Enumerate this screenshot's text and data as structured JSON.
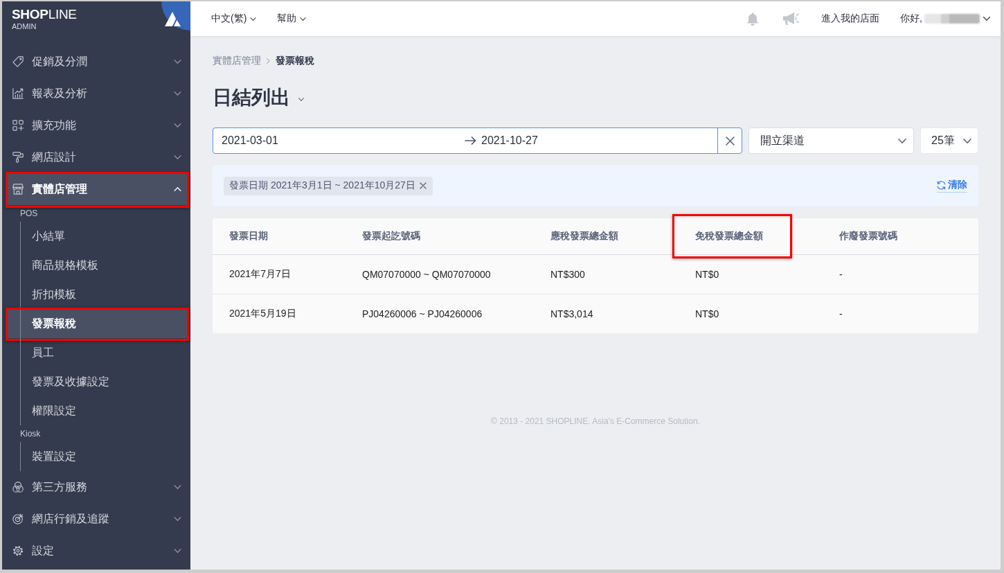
{
  "sidebar": {
    "brand": "**SHOP**LINE",
    "brand_subtitle": "ADMIN",
    "items": [
      {
        "label": "促銷及分潤",
        "expanded": false,
        "selected": false,
        "highlighted": false
      },
      {
        "label": "報表及分析",
        "expanded": false,
        "selected": false,
        "highlighted": false
      },
      {
        "label": "擴充功能",
        "expanded": false,
        "selected": false,
        "highlighted": false
      },
      {
        "label": "網店設計",
        "expanded": false,
        "selected": false,
        "highlighted": false
      },
      {
        "label": "實體店管理",
        "expanded": true,
        "selected": true,
        "highlighted": true,
        "groups": [
          {
            "label": "POS",
            "children": [
              {
                "label": "小結單",
                "selected": false,
                "highlighted": false
              },
              {
                "label": "商品規格模板",
                "selected": false,
                "highlighted": false
              },
              {
                "label": "折扣模板",
                "selected": false,
                "highlighted": false
              },
              {
                "label": "發票報稅",
                "selected": true,
                "highlighted": true
              },
              {
                "label": "員工",
                "selected": false,
                "highlighted": false
              },
              {
                "label": "發票及收據設定",
                "selected": false,
                "highlighted": false
              },
              {
                "label": "權限設定",
                "selected": false,
                "highlighted": false
              }
            ]
          },
          {
            "label": "Kiosk",
            "children": [
              {
                "label": "裝置設定",
                "selected": false,
                "highlighted": false
              }
            ]
          }
        ]
      },
      {
        "label": "第三方服務",
        "expanded": false,
        "selected": false,
        "highlighted": false
      },
      {
        "label": "網店行銷及追蹤",
        "expanded": false,
        "selected": false,
        "highlighted": false
      },
      {
        "label": "設定",
        "expanded": false,
        "selected": false,
        "highlighted": false
      }
    ]
  },
  "topbar": {
    "menus": [
      {
        "label": "中文(繁)"
      },
      {
        "label": "幫助"
      }
    ],
    "store_link": "進入我的店面",
    "greeting": "你好,"
  },
  "breadcrumb": [
    {
      "label": "實體店管理",
      "current": false
    },
    {
      "label": "發票報稅",
      "current": true
    }
  ],
  "title": "日結列出",
  "filters": {
    "date_range": {
      "start": "2021-03-01",
      "end": "2021-10-27"
    },
    "channel": {
      "value": "開立渠道"
    },
    "page_size": {
      "value": "25筆"
    }
  },
  "active_filters": {
    "chips": [
      {
        "label": "發票日期 2021年3月1日 ~ 2021年10月27日"
      }
    ],
    "clear_label": "清除"
  },
  "table": {
    "columns": [
      {
        "label": "發票日期",
        "highlighted": false
      },
      {
        "label": "發票起訖號碼",
        "highlighted": false
      },
      {
        "label": "應稅發票總金額",
        "highlighted": false
      },
      {
        "label": "免稅發票總金額",
        "highlighted": true
      },
      {
        "label": "作廢發票號碼",
        "highlighted": false
      }
    ],
    "rows": [
      {
        "cells": [
          "2021年7月7日",
          "QM07070000 ~ QM07070000",
          "NT$300",
          "NT$0",
          "-"
        ]
      },
      {
        "cells": [
          "2021年5月19日",
          "PJ04260006 ~ PJ04260006",
          "NT$3,014",
          "NT$0",
          "-"
        ]
      }
    ]
  },
  "footer": "© 2013 - 2021 SHOPLINE. Asia's E-Commerce Solution."
}
